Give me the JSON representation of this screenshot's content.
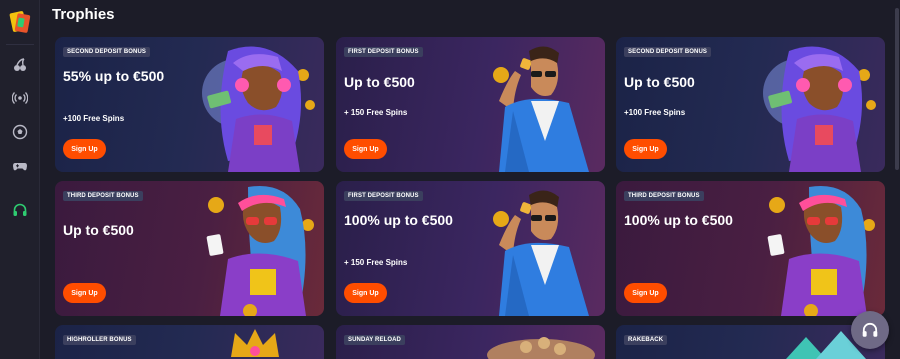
{
  "page": {
    "title": "Trophies"
  },
  "sidebar": {
    "icons": [
      "logo-icon",
      "cherry-icon",
      "live-signal-icon",
      "soccer-ball-icon",
      "gamepad-icon",
      "headphones-icon"
    ],
    "active_color": "#2ecc71"
  },
  "colors": {
    "accent": "#ff4d00",
    "badge_bg": "#3b3f5e"
  },
  "cards": [
    {
      "badge": "SECOND DEPOSIT BONUS",
      "title": "55% up to €500",
      "subtitle": "+100 Free Spins",
      "button": "Sign Up",
      "art": "woman-headphones"
    },
    {
      "badge": "FIRST DEPOSIT BONUS",
      "title": "Up to €500",
      "subtitle": "+ 150 Free Spins",
      "button": "Sign Up",
      "art": "man-suit"
    },
    {
      "badge": "SECOND DEPOSIT BONUS",
      "title": "Up to €500",
      "subtitle": "+100 Free Spins",
      "button": "Sign Up",
      "art": "woman-headphones"
    },
    {
      "badge": "THIRD DEPOSIT BONUS",
      "title": "Up to €500",
      "subtitle": "",
      "button": "Sign Up",
      "art": "woman-cards"
    },
    {
      "badge": "FIRST DEPOSIT BONUS",
      "title": "100% up to €500",
      "subtitle": "+ 150 Free Spins",
      "button": "Sign Up",
      "art": "man-suit"
    },
    {
      "badge": "THIRD DEPOSIT BONUS",
      "title": "100% up to €500",
      "subtitle": "",
      "button": "Sign Up",
      "art": "woman-cards"
    },
    {
      "badge": "HIGHROLLER BONUS",
      "title": "",
      "subtitle": "",
      "button": "",
      "art": "partial"
    },
    {
      "badge": "SUNDAY RELOAD",
      "title": "",
      "subtitle": "",
      "button": "",
      "art": "partial"
    },
    {
      "badge": "RAKEBACK",
      "title": "",
      "subtitle": "",
      "button": "",
      "art": "partial"
    }
  ],
  "support": {
    "icon": "headphones-icon"
  }
}
